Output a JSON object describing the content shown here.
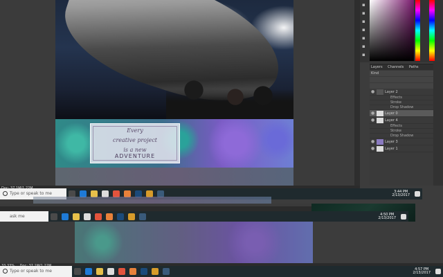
{
  "banner": {
    "line1": "Every",
    "line2": "creative project",
    "line3": "is a new",
    "line4": "ADVENTURE"
  },
  "layers_panel": {
    "tabs": [
      "Layers",
      "Channels",
      "Paths"
    ],
    "filter": "Kind",
    "items": [
      {
        "label": "Layer 2",
        "type": "layer"
      },
      {
        "label": "Effects",
        "type": "fx"
      },
      {
        "label": "Stroke",
        "type": "fx"
      },
      {
        "label": "Drop Shadow",
        "type": "fx"
      },
      {
        "label": "Layer 0",
        "type": "layer"
      },
      {
        "label": "Layer 4",
        "type": "layer"
      },
      {
        "label": "Effects",
        "type": "fx"
      },
      {
        "label": "Stroke",
        "type": "fx"
      },
      {
        "label": "Drop Shadow",
        "type": "fx"
      },
      {
        "label": "Layer 3",
        "type": "layer"
      },
      {
        "label": "Layer 1",
        "type": "layer"
      }
    ]
  },
  "status_bars": {
    "upper": "Doc: 37.1M/1.22M",
    "lower": "Doc: 37.1M/1.22M",
    "zoom": "33.33%"
  },
  "taskbars": [
    {
      "search_placeholder": "Type or speak to me",
      "time": "3:44 PM",
      "date": "2/13/2017"
    },
    {
      "search_placeholder": "ask me",
      "time": "4:50 PM",
      "date": "2/13/2017"
    },
    {
      "search_placeholder": "Type or speak to me",
      "time": "4:57 PM",
      "date": "2/13/2017"
    }
  ],
  "colors": {
    "taskbar": "#1f2a2e",
    "banner_teal": "#2f8a88",
    "banner_purple": "#7a5bc4"
  }
}
